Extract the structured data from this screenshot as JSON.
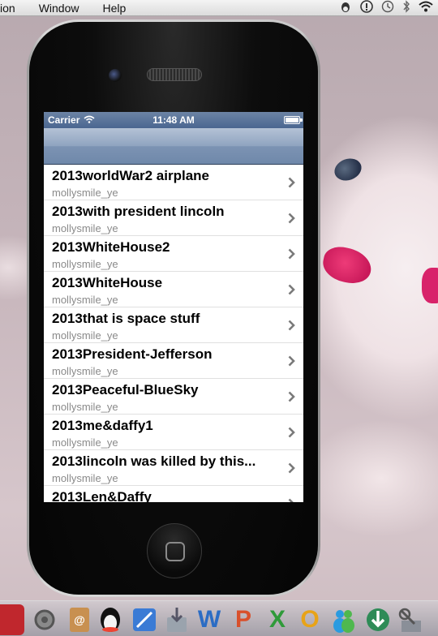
{
  "menubar": {
    "app_menu_fragment": "ion",
    "menus": [
      "Window",
      "Help"
    ],
    "tray_icons": [
      "qq-tray-icon",
      "alert-tray-icon",
      "time-machine-icon",
      "bluetooth-icon",
      "wifi-icon"
    ]
  },
  "simulator": {
    "status_bar": {
      "carrier": "Carrier",
      "time": "11:48 AM"
    },
    "nav_bar": {
      "title": ""
    },
    "list": [
      {
        "title": "2013worldWar2 airplane",
        "subtitle": "mollysmile_ye"
      },
      {
        "title": "2013with president lincoln",
        "subtitle": "mollysmile_ye"
      },
      {
        "title": "2013WhiteHouse2",
        "subtitle": "mollysmile_ye"
      },
      {
        "title": "2013WhiteHouse",
        "subtitle": "mollysmile_ye"
      },
      {
        "title": "2013that is space stuff",
        "subtitle": "mollysmile_ye"
      },
      {
        "title": "2013President-Jefferson",
        "subtitle": "mollysmile_ye"
      },
      {
        "title": "2013Peaceful-BlueSky",
        "subtitle": "mollysmile_ye"
      },
      {
        "title": "2013me&daffy1",
        "subtitle": "mollysmile_ye"
      },
      {
        "title": "2013lincoln was killed by this...",
        "subtitle": "mollysmile_ye"
      },
      {
        "title": "2013Len&Daffy",
        "subtitle": ""
      }
    ]
  },
  "dock": {
    "icons": [
      {
        "name": "photo-booth-icon",
        "color": "#c0272d"
      },
      {
        "name": "system-preferences-icon",
        "color": "#7a7a7a"
      },
      {
        "name": "address-book-icon",
        "color": "#b07a3c"
      },
      {
        "name": "qq-penguin-icon",
        "color": "#222222"
      },
      {
        "name": "xcode-icon",
        "color": "#3a7bd5"
      },
      {
        "name": "archive-utility-icon",
        "color": "#9aa3ad"
      },
      {
        "name": "word-icon",
        "color": "#2b6cc4"
      },
      {
        "name": "powerpoint-icon",
        "color": "#d9502b"
      },
      {
        "name": "excel-icon",
        "color": "#2f9a3a"
      },
      {
        "name": "outlook-icon",
        "color": "#e8a317"
      },
      {
        "name": "messenger-icon",
        "color": "#2a9be0"
      },
      {
        "name": "download-icon",
        "color": "#2e8b57"
      },
      {
        "name": "satellite-icon",
        "color": "#8a8f98"
      }
    ]
  }
}
